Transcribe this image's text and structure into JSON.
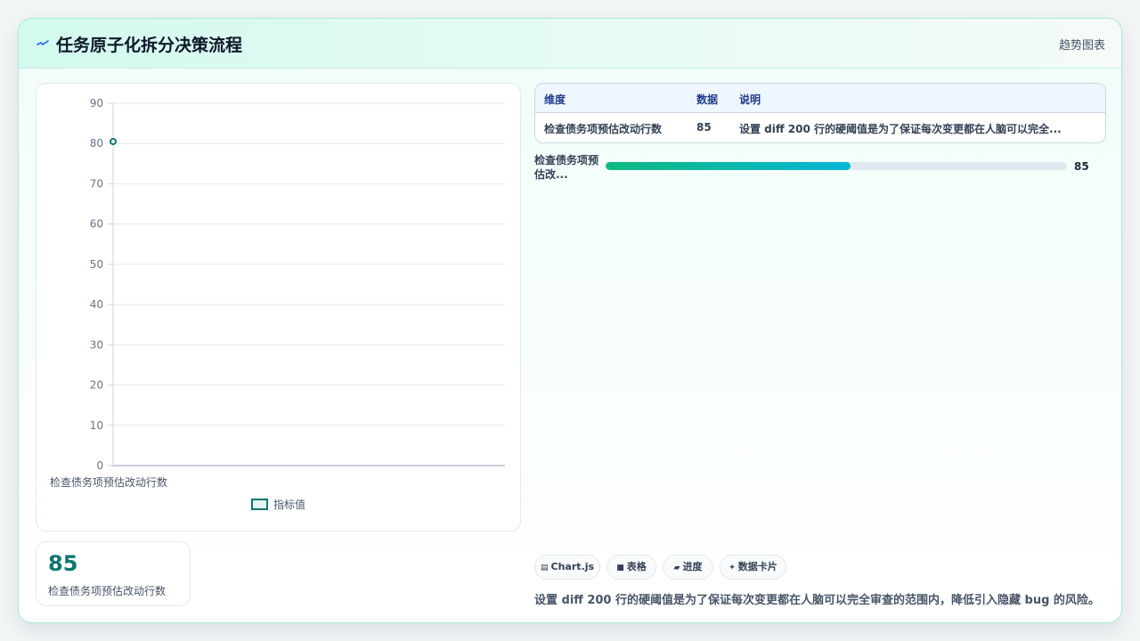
{
  "header": {
    "title": "任务原子化拆分决策流程",
    "right_label": "趋势图表"
  },
  "chart_data": {
    "type": "line",
    "categories": [
      "检查债务项预估改动行数"
    ],
    "series": [
      {
        "name": "指标值",
        "values": [
          80.5
        ]
      }
    ],
    "ylim": [
      0,
      90
    ],
    "yticks": [
      "0",
      "10",
      "20",
      "30",
      "40",
      "50",
      "60",
      "70",
      "80",
      "90"
    ],
    "grid": true,
    "legend": "bottom",
    "colors": {
      "line": "#0f766e",
      "grid": "#e5e7eb"
    }
  },
  "stat": {
    "value": "85",
    "label": "检查债务项预估改动行数"
  },
  "table": {
    "headers": [
      "维度",
      "数据",
      "说明"
    ],
    "rows": [
      [
        "检查债务项预估改动行数",
        "85",
        "设置 diff 200 行的硬阈值是为了保证每次变更都在人脑可以完全..."
      ]
    ]
  },
  "progress": {
    "label": "检查债务项预估改...",
    "value_text": "85",
    "fraction": 0.53
  },
  "chips": [
    {
      "icon": "chart-icon",
      "label": "Chart.js"
    },
    {
      "icon": "table-icon",
      "label": "表格"
    },
    {
      "icon": "progress-icon",
      "label": "进度"
    },
    {
      "icon": "sparkle-icon",
      "label": "数据卡片"
    }
  ],
  "summary": "设置 diff 200 行的硬阈值是为了保证每次变更都在人脑可以完全审查的范围内，降低引入隐藏 bug 的风险。",
  "colors": {
    "accent": "#0f766e",
    "bar_start": "#10b981",
    "bar_end": "#06b6d4"
  }
}
